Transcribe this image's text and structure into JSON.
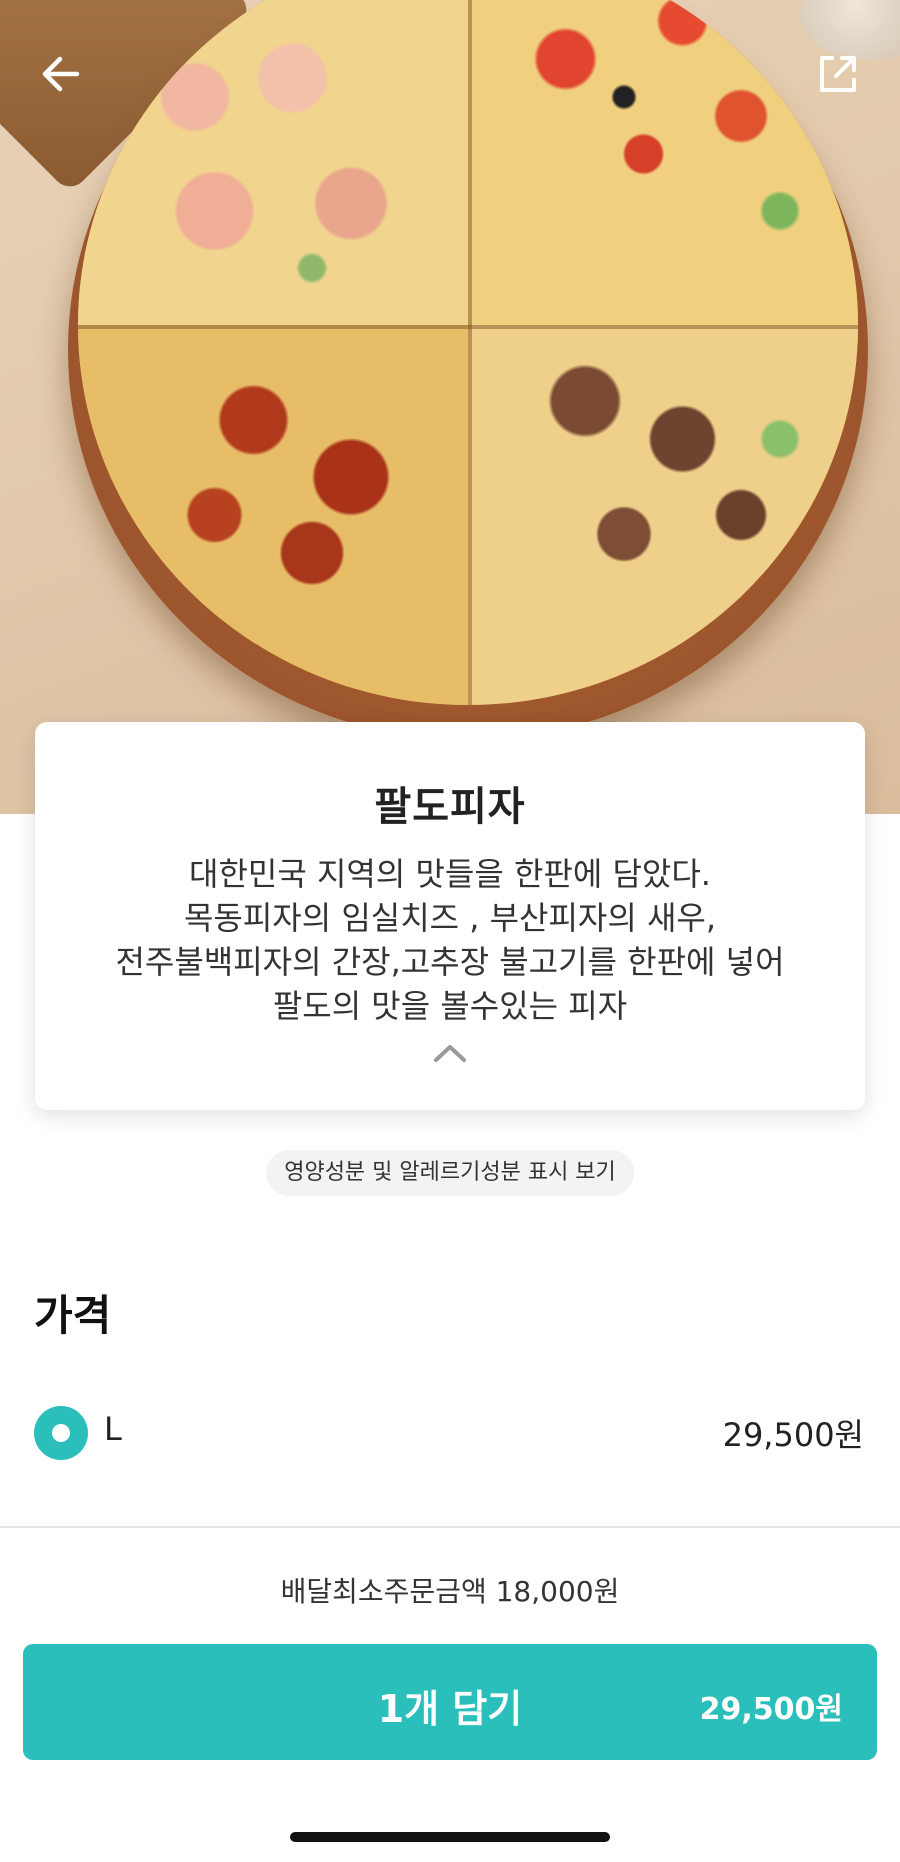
{
  "product": {
    "name": "팔도피자",
    "description_lines": [
      "대한민국 지역의 맛들을 한판에 담았다.",
      "목동피자의 임실치즈 , 부산피자의 새우,",
      "전주불백피자의 간장,고추장 불고기를 한판에 넣어",
      "팔도의 맛을 볼수있는 피자"
    ]
  },
  "nutrition_link": "영양성분 및 알레르기성분 표시 보기",
  "price_section": {
    "heading": "가격",
    "options": [
      {
        "label": "L",
        "price": "29,500원",
        "selected": true
      }
    ]
  },
  "footer": {
    "min_order": "배달최소주문금액 18,000원",
    "cart_label": "1개 담기",
    "cart_price": "29,500원"
  },
  "icons": {
    "back": "back-arrow-icon",
    "share": "share-icon",
    "collapse": "chevron-up-icon"
  },
  "colors": {
    "accent": "#2bbfbb"
  }
}
